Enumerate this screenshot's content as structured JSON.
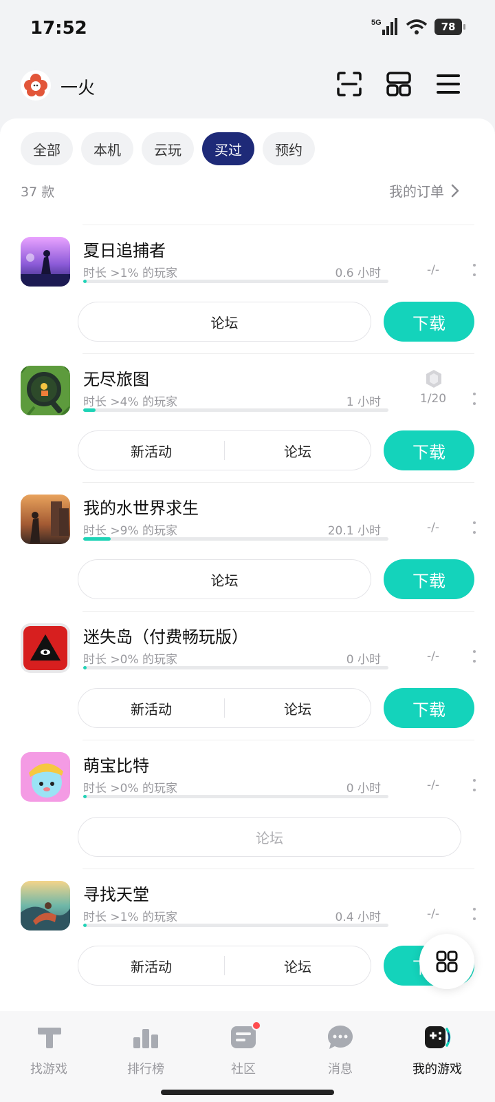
{
  "status": {
    "time": "17:52",
    "network": "5G",
    "battery": "78"
  },
  "header": {
    "username": "一火"
  },
  "tabs": [
    {
      "label": "全部",
      "active": false
    },
    {
      "label": "本机",
      "active": false
    },
    {
      "label": "云玩",
      "active": false
    },
    {
      "label": "买过",
      "active": true
    },
    {
      "label": "预约",
      "active": false
    }
  ],
  "summary": {
    "count": "37 款",
    "orders": "我的订单"
  },
  "games": [
    {
      "name": "夏日追捕者",
      "stat": "时长 >1% 的玩家",
      "hours": "0.6 小时",
      "progress": 0.01,
      "achievement": "-/-",
      "buttons": [
        "论坛"
      ],
      "download": "下载"
    },
    {
      "name": "无尽旅图",
      "stat": "时长 >4% 的玩家",
      "hours": "1 小时",
      "progress": 0.04,
      "achievement": "1/20",
      "buttons": [
        "新活动",
        "论坛"
      ],
      "download": "下载"
    },
    {
      "name": "我的水世界求生",
      "stat": "时长 >9% 的玩家",
      "hours": "20.1 小时",
      "progress": 0.09,
      "achievement": "-/-",
      "buttons": [
        "论坛"
      ],
      "download": "下载"
    },
    {
      "name": "迷失岛（付费畅玩版）",
      "stat": "时长 >0% 的玩家",
      "hours": "0 小时",
      "progress": 0.0,
      "achievement": "-/-",
      "buttons": [
        "新活动",
        "论坛"
      ],
      "download": "下载"
    },
    {
      "name": "萌宝比特",
      "stat": "时长 >0% 的玩家",
      "hours": "0 小时",
      "progress": 0.0,
      "achievement": "-/-",
      "buttons": [
        "论坛"
      ],
      "download": ""
    },
    {
      "name": "寻找天堂",
      "stat": "时长 >1% 的玩家",
      "hours": "0.4 小时",
      "progress": 0.01,
      "achievement": "-/-",
      "buttons": [
        "新活动",
        "论坛"
      ],
      "download": "下载"
    }
  ],
  "nav": [
    {
      "label": "找游戏",
      "icon": "find-games-icon",
      "active": false
    },
    {
      "label": "排行榜",
      "icon": "ranking-icon",
      "active": false
    },
    {
      "label": "社区",
      "icon": "community-icon",
      "active": false,
      "badge": true
    },
    {
      "label": "消息",
      "icon": "messages-icon",
      "active": false
    },
    {
      "label": "我的游戏",
      "icon": "my-games-icon",
      "active": true
    }
  ],
  "colors": {
    "accent": "#14d3bb",
    "active_tab": "#1e2a78",
    "progress": "#1ed3b6",
    "badge": "#ff4d4f"
  }
}
